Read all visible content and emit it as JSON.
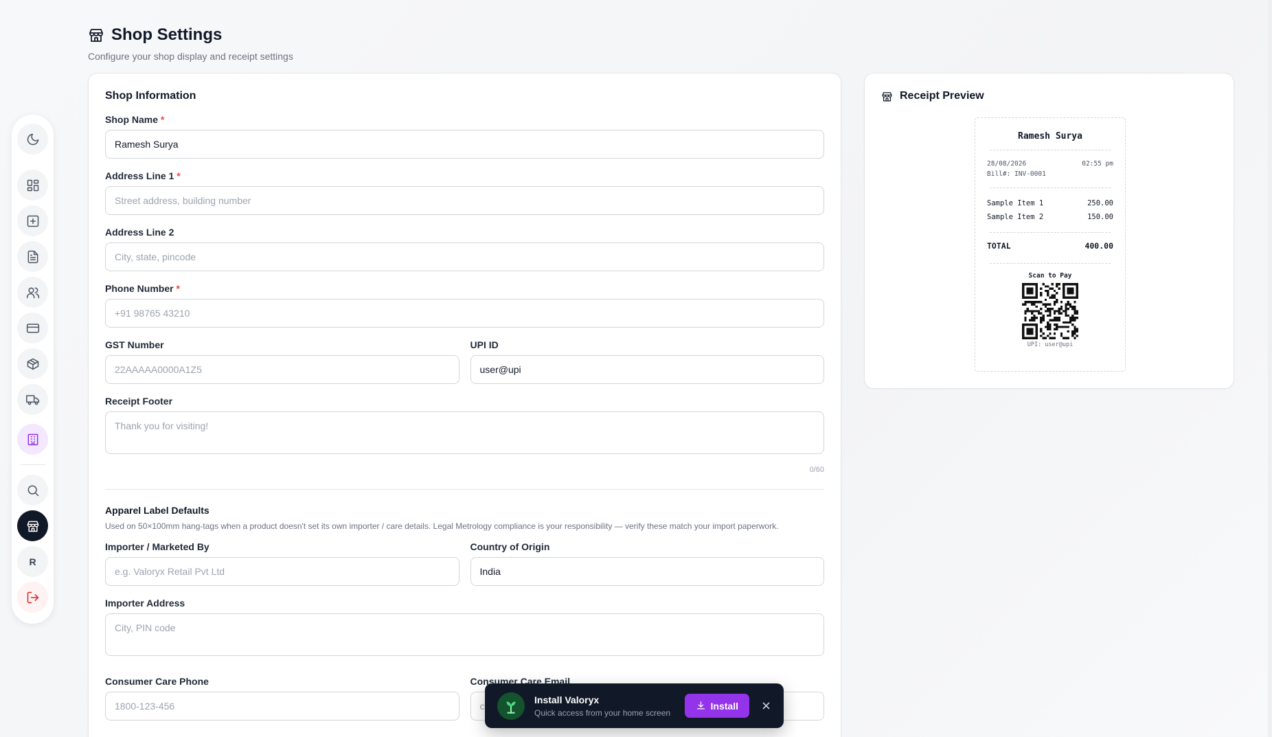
{
  "header": {
    "title": "Shop Settings",
    "subtitle": "Configure your shop display and receipt settings"
  },
  "sidebar": {
    "items": [
      {
        "icon": "moon-icon"
      },
      {
        "icon": "dashboard-icon"
      },
      {
        "icon": "new-bill-icon"
      },
      {
        "icon": "document-icon"
      },
      {
        "icon": "users-icon"
      },
      {
        "icon": "card-icon"
      },
      {
        "icon": "package-icon"
      },
      {
        "icon": "truck-icon"
      },
      {
        "icon": "building-icon"
      },
      {
        "icon": "search-icon"
      },
      {
        "icon": "store-icon"
      },
      {
        "icon": "user-initial"
      },
      {
        "icon": "logout-icon"
      }
    ],
    "user_initial": "R"
  },
  "shop_info": {
    "title": "Shop Information",
    "shop_name": {
      "label": "Shop Name",
      "required": "*",
      "value": "Ramesh Surya"
    },
    "address1": {
      "label": "Address Line 1",
      "required": "*",
      "placeholder": "Street address, building number"
    },
    "address2": {
      "label": "Address Line 2",
      "placeholder": "City, state, pincode"
    },
    "phone": {
      "label": "Phone Number",
      "required": "*",
      "placeholder": "+91 98765 43210"
    },
    "gst": {
      "label": "GST Number",
      "placeholder": "22AAAAA0000A1Z5"
    },
    "upi": {
      "label": "UPI ID",
      "value": "user@upi"
    },
    "footer": {
      "label": "Receipt Footer",
      "placeholder": "Thank you for visiting!",
      "counter": "0/60"
    }
  },
  "apparel": {
    "title": "Apparel Label Defaults",
    "description": "Used on 50×100mm hang-tags when a product doesn't set its own importer / care details. Legal Metrology compliance is your responsibility — verify these match your import paperwork.",
    "importer": {
      "label": "Importer / Marketed By",
      "placeholder": "e.g. Valoryx Retail Pvt Ltd"
    },
    "country": {
      "label": "Country of Origin",
      "value": "India"
    },
    "importer_address": {
      "label": "Importer Address",
      "placeholder": "City, PIN code"
    },
    "care_phone": {
      "label": "Consumer Care Phone",
      "placeholder": "1800-123-456"
    },
    "care_email": {
      "label": "Consumer Care Email",
      "placeholder": "c"
    }
  },
  "preview": {
    "title": "Receipt Preview",
    "receipt": {
      "shop_name": "Ramesh Surya",
      "date": "28/08/2026",
      "time": "02:55 pm",
      "bill_no": "Bill#: INV-0001",
      "items": [
        {
          "name": "Sample Item 1",
          "price": "250.00"
        },
        {
          "name": "Sample Item 2",
          "price": "150.00"
        }
      ],
      "total_label": "TOTAL",
      "total_value": "400.00",
      "scan_label": "Scan to Pay",
      "upi_line": "UPI: user@upi"
    }
  },
  "install_toast": {
    "title": "Install Valoryx",
    "subtitle": "Quick access from your home screen",
    "button_label": "Install"
  },
  "colors": {
    "accent": "#9333ea",
    "required": "#ef4444",
    "active_nav": "#111827",
    "logout": "#dc2626"
  }
}
